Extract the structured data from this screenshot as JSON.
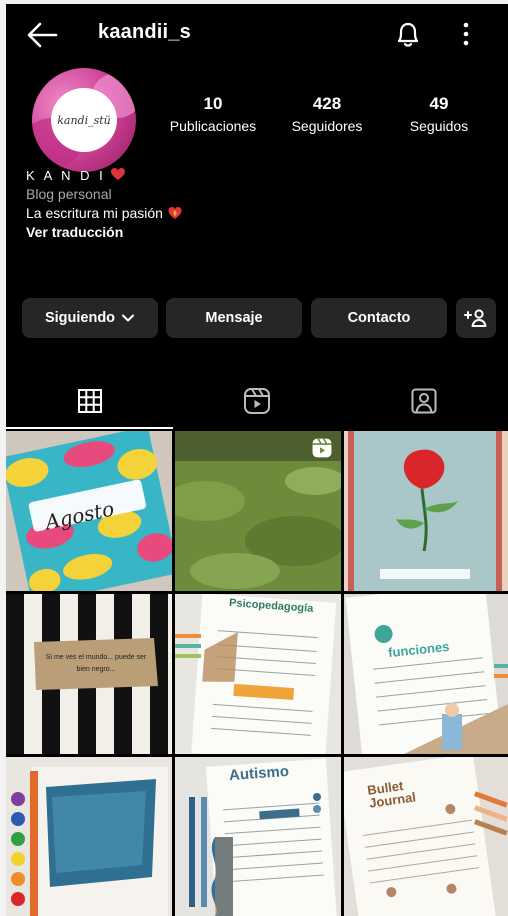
{
  "header": {
    "username": "kaandii_s"
  },
  "profile": {
    "avatar_text": "kandi_stü",
    "stats": [
      {
        "value": "10",
        "label": "Publicaciones"
      },
      {
        "value": "428",
        "label": "Seguidores"
      },
      {
        "value": "49",
        "label": "Seguidos"
      }
    ],
    "name": "K A N D I",
    "category": "Blog personal",
    "bio": "La escritura mi pasión",
    "translate": "Ver traducción"
  },
  "actions": {
    "following": "Siguiendo",
    "message": "Mensaje",
    "contact": "Contacto"
  },
  "tabs": [
    "posts-grid",
    "reels",
    "tagged"
  ],
  "posts": [
    {
      "text": "Agosto"
    },
    {
      "text": ""
    },
    {
      "text": ""
    },
    {
      "text": "Si me ves el mundo... puede ser bien negro..."
    },
    {
      "text": "Psicopedagogía"
    },
    {
      "text": "funciones"
    },
    {
      "text": ""
    },
    {
      "text": "Autismo"
    },
    {
      "text": "Bullet Journal"
    }
  ]
}
